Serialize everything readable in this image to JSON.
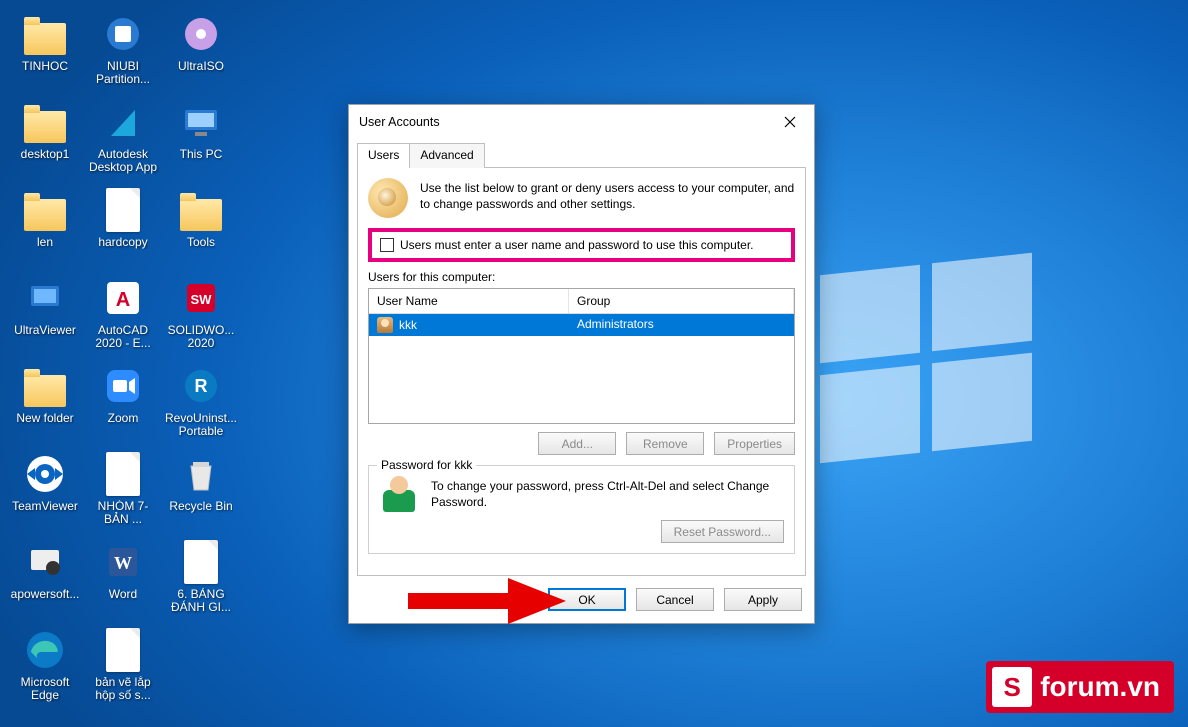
{
  "desktop": {
    "icons": [
      {
        "label": "TINHOC",
        "kind": "folder"
      },
      {
        "label": "desktop1",
        "kind": "folder"
      },
      {
        "label": "len",
        "kind": "folder"
      },
      {
        "label": "UltraViewer",
        "kind": "app-uv"
      },
      {
        "label": "New folder",
        "kind": "folder"
      },
      {
        "label": "TeamViewer",
        "kind": "app-tv"
      },
      {
        "label": "apowersoft...",
        "kind": "app-apw"
      },
      {
        "label": "Microsoft Edge",
        "kind": "app-edge"
      },
      {
        "label": "NIUBI Partition...",
        "kind": "app-niubi"
      },
      {
        "label": "Autodesk Desktop App",
        "kind": "app-adsk"
      },
      {
        "label": "hardcopy",
        "kind": "doc"
      },
      {
        "label": "AutoCAD 2020 - E...",
        "kind": "app-acad"
      },
      {
        "label": "Zoom",
        "kind": "app-zoom"
      },
      {
        "label": "NHÓM 7-BẢN ...",
        "kind": "doc"
      },
      {
        "label": "Word",
        "kind": "app-word"
      },
      {
        "label": "bản vẽ lắp hộp số s...",
        "kind": "doc"
      },
      {
        "label": "UltraISO",
        "kind": "app-uiso"
      },
      {
        "label": "This PC",
        "kind": "thispc"
      },
      {
        "label": "Tools",
        "kind": "folder-shortcut"
      },
      {
        "label": "SOLIDWO... 2020",
        "kind": "app-sw"
      },
      {
        "label": "RevoUninst... Portable",
        "kind": "app-revo"
      },
      {
        "label": "Recycle Bin",
        "kind": "recycle"
      },
      {
        "label": "6. BẢNG ĐÁNH GI...",
        "kind": "doc-word"
      }
    ]
  },
  "dialog": {
    "title": "User Accounts",
    "tabs": {
      "users": "Users",
      "advanced": "Advanced"
    },
    "hint": "Use the list below to grant or deny users access to your computer, and to change passwords and other settings.",
    "checkbox_label": "Users must enter a user name and password to use this computer.",
    "checkbox_checked": false,
    "list": {
      "caption": "Users for this computer:",
      "columns": {
        "user": "User Name",
        "group": "Group"
      },
      "rows": [
        {
          "user": "kkk",
          "group": "Administrators"
        }
      ]
    },
    "row_buttons": {
      "add": "Add...",
      "remove": "Remove",
      "properties": "Properties"
    },
    "password_group": {
      "legend": "Password for kkk",
      "text": "To change your password, press Ctrl-Alt-Del and select Change Password.",
      "reset": "Reset Password..."
    },
    "dialog_buttons": {
      "ok": "OK",
      "cancel": "Cancel",
      "apply": "Apply"
    }
  },
  "watermark": {
    "badge": "S",
    "text": "forum.vn"
  }
}
